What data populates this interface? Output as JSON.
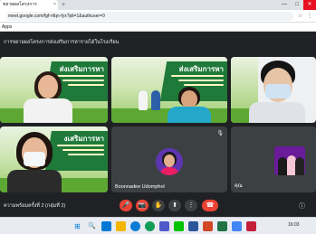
{
  "browser": {
    "tab_title": "ขยายผลโครงการ",
    "tab_close": "×",
    "new_tab": "+",
    "url": "meet.google.com/fgf-nfqn-fyx?pli=1&authuser=0",
    "bookmark": "Apps",
    "window_buttons": {
      "minimize": "—",
      "maximize": "□",
      "close": "✕"
    }
  },
  "meet": {
    "presenting_title": "การขยายผลโครงการส่งเสริมการหารายได้ในโรงเรียน",
    "slide": {
      "title": "ส่งเสริมการหา",
      "title_partial": "งเสริมการหา"
    },
    "participants": [
      {
        "name": "",
        "muted": false
      },
      {
        "name": "",
        "muted": false
      },
      {
        "name": "",
        "muted": false
      },
      {
        "name": "",
        "muted": false
      },
      {
        "name": "Boonnadee Udomphol",
        "muted": true
      },
      {
        "name": "คุณ",
        "muted": false
      }
    ],
    "meeting_name": "ความพร้อมครั้งที่ 2 (กลุ่มที่ 2)"
  },
  "controls": {
    "mic": "🎤",
    "camera": "📷",
    "raise_hand": "✋",
    "present": "⬆",
    "more": "⋮",
    "end_call": "☎",
    "info": "ⓘ"
  },
  "taskbar": {
    "start": "⊞",
    "search": "🔍",
    "clock": "16:03"
  },
  "colors": {
    "meet_bg": "#202124",
    "tile_bg": "#3c4043",
    "end_call": "#ea4335",
    "slide_green": "#1f7a3a"
  }
}
